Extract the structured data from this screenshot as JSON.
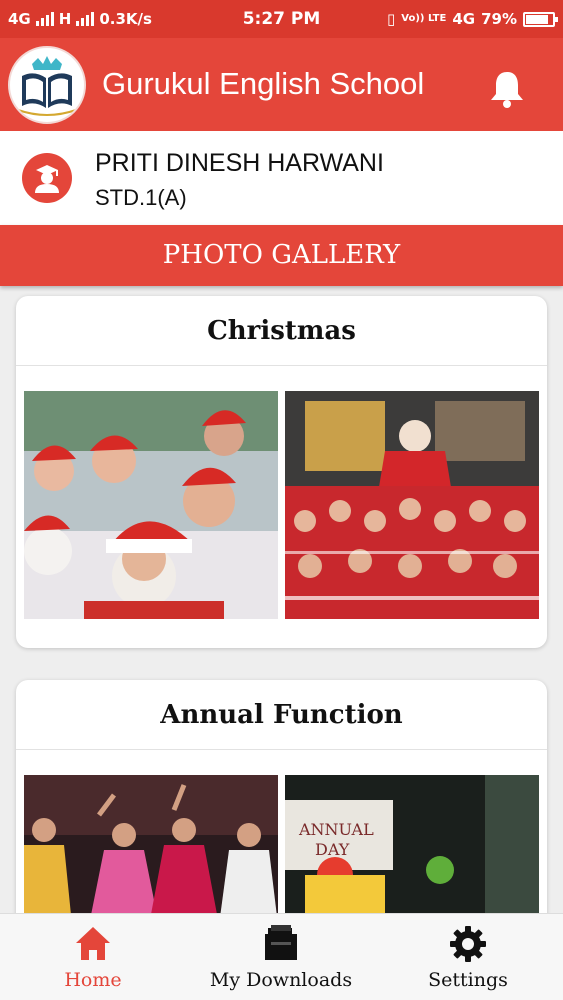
{
  "status_bar": {
    "network_left": "4G",
    "network_mid": "H",
    "speed": "0.3K/s",
    "time": "5:27 PM",
    "volte": "Vo)) LTE",
    "network_right": "4G",
    "battery": "79%"
  },
  "app_bar": {
    "title": "Gurukul English School",
    "logo_icon": "school-book-crown-logo",
    "bell_icon": "bell-icon"
  },
  "student": {
    "name": "PRITI DINESH HARWANI",
    "class": "STD.1(A)"
  },
  "section_title": "PHOTO GALLERY",
  "albums": [
    {
      "title": "Christmas"
    },
    {
      "title": "Annual Function"
    }
  ],
  "bottom_nav": {
    "items": [
      {
        "label": "Home",
        "icon": "home-icon"
      },
      {
        "label": "My Downloads",
        "icon": "downloads-icon"
      },
      {
        "label": "Settings",
        "icon": "gear-icon"
      }
    ]
  },
  "colors": {
    "primary": "#e4463a",
    "status_bar": "#d9392d",
    "background": "#eeeeee"
  }
}
